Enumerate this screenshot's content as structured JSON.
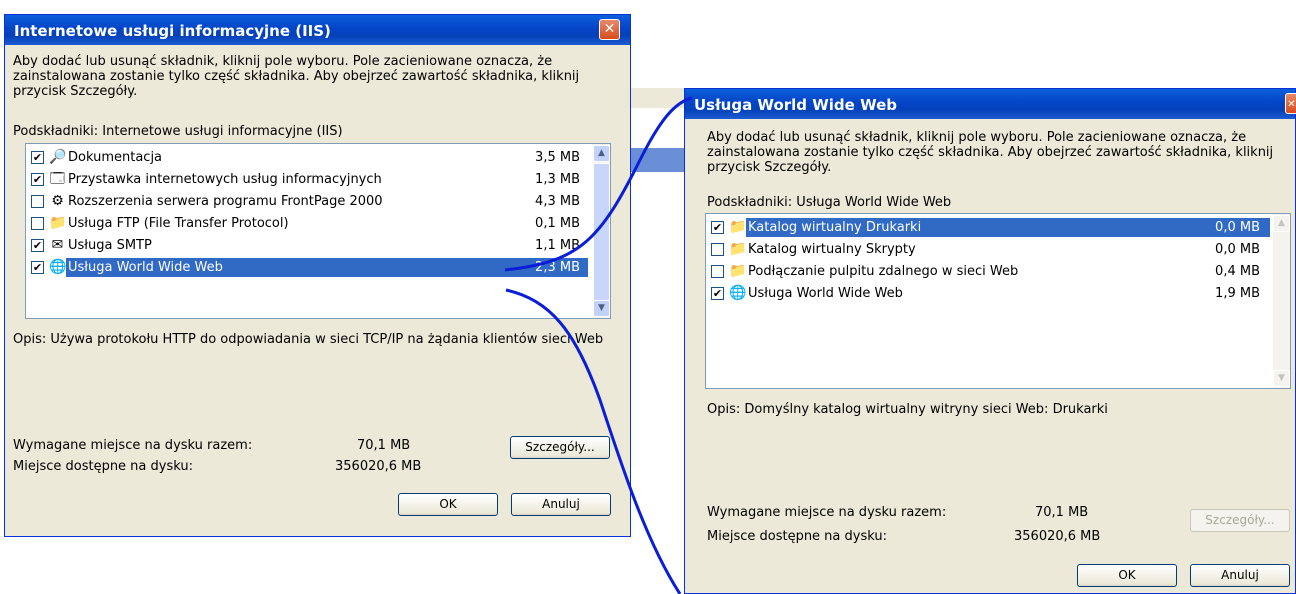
{
  "colors": {
    "title_bar": "#0450d0",
    "selection": "#316ac5",
    "dialog_bg": "#ece9d8",
    "annotation": "#0a1ed8"
  },
  "dialog_iis": {
    "title": "Internetowe usługi informacyjne (IIS)",
    "instructions": "Aby dodać lub usunąć składnik, kliknij pole wyboru. Pole zacieniowane oznacza, że zainstalowana zostanie tylko część składnika. Aby obejrzeć zawartość składnika, kliknij przycisk Szczegóły.",
    "subcomponents_label": "Podskładniki: Internetowe usługi informacyjne (IIS)",
    "items": [
      {
        "label": "Dokumentacja",
        "size": "3,5 MB",
        "checked": true,
        "icon": "help-globe-icon"
      },
      {
        "label": "Przystawka internetowych usług informacyjnych",
        "size": "1,3 MB",
        "checked": true,
        "icon": "mmc-snapin-icon"
      },
      {
        "label": "Rozszerzenia serwera programu FrontPage 2000",
        "size": "4,3 MB",
        "checked": false,
        "icon": "gears-icon"
      },
      {
        "label": "Usługa FTP (File Transfer Protocol)",
        "size": "0,1 MB",
        "checked": false,
        "icon": "folder-icon"
      },
      {
        "label": "Usługa SMTP",
        "size": "1,1 MB",
        "checked": true,
        "icon": "mail-icon"
      },
      {
        "label": "Usługa World Wide Web",
        "size": "2,3 MB",
        "checked": true,
        "icon": "web-globe-icon",
        "selected": true
      }
    ],
    "description": "Opis:  Używa protokołu HTTP do odpowiadania w sieci TCP/IP na żądania klientów sieci Web",
    "required_label": "Wymagane miejsce na dysku razem:",
    "required_value": "70,1 MB",
    "available_label": "Miejsce dostępne na dysku:",
    "available_value": "356020,6 MB",
    "details_button": "Szczegóły...",
    "ok_button": "OK",
    "cancel_button": "Anuluj"
  },
  "dialog_www": {
    "title": "Usługa World Wide Web",
    "instructions": "Aby dodać lub usunąć składnik, kliknij pole wyboru. Pole zacieniowane oznacza, że zainstalowana zostanie tylko część składnika. Aby obejrzeć zawartość składnika, kliknij przycisk Szczegóły.",
    "subcomponents_label": "Podskładniki: Usługa World Wide Web",
    "items": [
      {
        "label": "Katalog wirtualny Drukarki",
        "size": "0,0 MB",
        "checked": true,
        "icon": "folder-icon",
        "selected": true
      },
      {
        "label": "Katalog wirtualny Skrypty",
        "size": "0,0 MB",
        "checked": false,
        "icon": "folder-icon"
      },
      {
        "label": "Podłączanie pulpitu zdalnego w sieci Web",
        "size": "0,4 MB",
        "checked": false,
        "icon": "folder-icon"
      },
      {
        "label": "Usługa World Wide Web",
        "size": "1,9 MB",
        "checked": true,
        "icon": "web-globe-icon"
      }
    ],
    "description": "Opis:  Domyślny katalog wirtualny witryny sieci Web: Drukarki",
    "required_label": "Wymagane miejsce na dysku razem:",
    "required_value": "70,1 MB",
    "available_label": "Miejsce dostępne na dysku:",
    "available_value": "356020,6 MB",
    "details_button": "Szczegóły...",
    "ok_button": "OK",
    "cancel_button": "Anuluj"
  },
  "close_glyph": "✕"
}
